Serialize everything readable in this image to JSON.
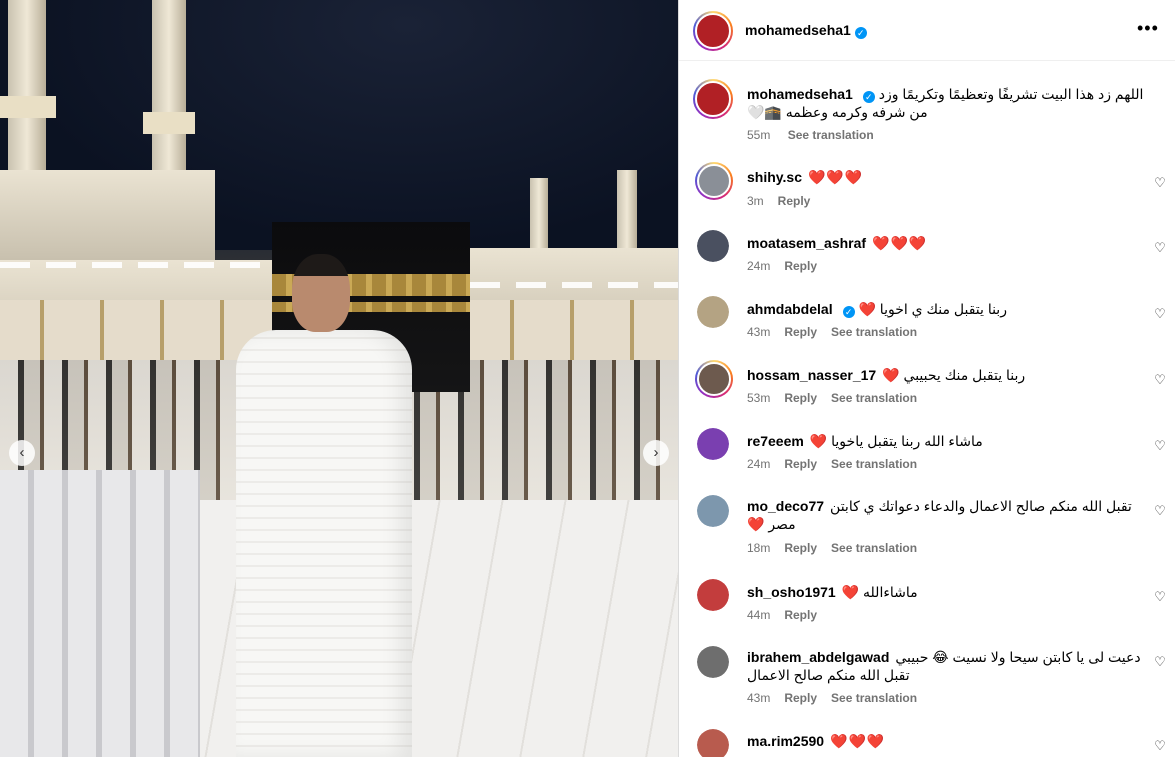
{
  "post": {
    "author": "mohamedseha1",
    "verified": true,
    "more_icon": "more-horizontal-icon",
    "caption_user": "mohamedseha1",
    "caption_text": "اللهم زد هذا البيت تشريفًا وتعظيمًا وتكريمًا وزد من شرفه وكرمه وعظمه 🕋🤍",
    "caption_time": "55m",
    "caption_translate": "See translation"
  },
  "carousel": {
    "prev_icon": "chevron-left-icon",
    "next_icon": "chevron-right-icon"
  },
  "comments": [
    {
      "user": "shihy.sc",
      "verified": false,
      "text": "❤️❤️❤️",
      "time": "3m",
      "reply": "Reply",
      "translate": "",
      "avatar": "#8a8f97"
    },
    {
      "user": "moatasem_ashraf",
      "verified": false,
      "text": "❤️❤️❤️",
      "time": "24m",
      "reply": "Reply",
      "translate": "",
      "avatar": "#4a5060"
    },
    {
      "user": "ahmdabdelal",
      "verified": true,
      "text": "ربنا يتقبل منك ي اخويا ❤️",
      "time": "43m",
      "reply": "Reply",
      "translate": "See translation",
      "avatar": "#b4a383"
    },
    {
      "user": "hossam_nasser_17",
      "verified": false,
      "text": "ربنا يتقبل منك يحبيبي ❤️",
      "time": "53m",
      "reply": "Reply",
      "translate": "See translation",
      "avatar": "#6d5a4e"
    },
    {
      "user": "re7eeem",
      "verified": false,
      "text": "ماشاء الله ربنا يتقبل ياخويا ❤️",
      "time": "24m",
      "reply": "Reply",
      "translate": "See translation",
      "avatar": "#7a3fb0"
    },
    {
      "user": "mo_deco77",
      "verified": false,
      "text": "تقبل الله منكم صالح الاعمال والدعاء دعواتك ي كابتن مصر ❤️",
      "time": "18m",
      "reply": "Reply",
      "translate": "See translation",
      "avatar": "#7d97ad"
    },
    {
      "user": "sh_osho1971",
      "verified": false,
      "text": "ماشاءالله ❤️",
      "time": "44m",
      "reply": "Reply",
      "translate": "",
      "avatar": "#c33d3d"
    },
    {
      "user": "ibrahem_abdelgawad",
      "verified": false,
      "text": "دعيت لى يا كابتن سيحا ولا نسيت 😂 حبيبي تقبل الله منكم صالح الاعمال",
      "time": "43m",
      "reply": "Reply",
      "translate": "See translation",
      "avatar": "#6e6e6e"
    },
    {
      "user": "ma.rim2590",
      "verified": false,
      "text": "❤️❤️❤️",
      "time": "",
      "reply": "",
      "translate": "",
      "avatar": "#b85b4e"
    }
  ]
}
